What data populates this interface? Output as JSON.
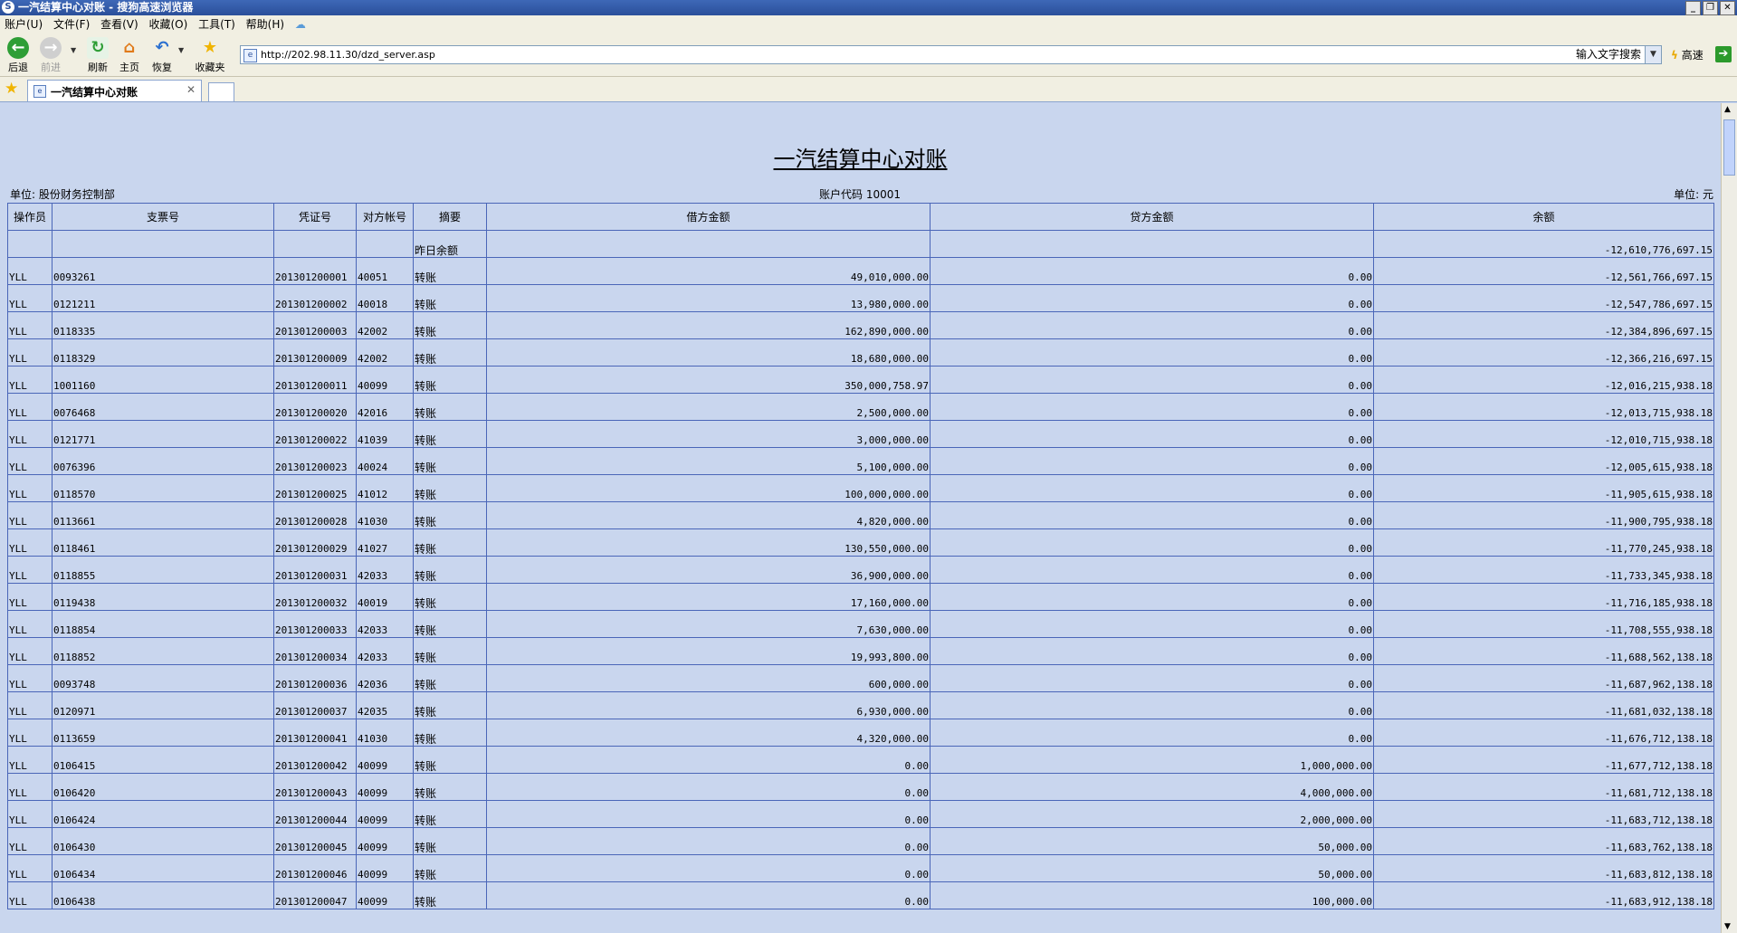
{
  "window": {
    "title": "一汽结算中心对账 - 搜狗高速浏览器",
    "app_icon": "S"
  },
  "menu": [
    "账户(U)",
    "文件(F)",
    "查看(V)",
    "收藏(O)",
    "工具(T)",
    "帮助(H)"
  ],
  "toolbar": {
    "back_label": "后退",
    "forward_label": "前进",
    "refresh_label": "刷新",
    "home_label": "主页",
    "restore_label": "恢复",
    "favorites_label": "收藏夹",
    "url": "http://202.98.11.30/dzd_server.asp",
    "search_label": "输入文字搜索",
    "speed_label": "高速"
  },
  "tabs": [
    {
      "title": "一汽结算中心对账"
    }
  ],
  "report": {
    "title": "一汽结算中心对账",
    "unit_dept_label": "单位: 股份财务控制部",
    "account_code_label": "账户代码 10001",
    "currency_unit_label": "单位: 元",
    "columns": [
      "操作员",
      "支票号",
      "凭证号",
      "对方帐号",
      "摘要",
      "借方金额",
      "贷方金额",
      "余额"
    ],
    "opening_row": {
      "summary": "昨日余额",
      "balance": "-12,610,776,697.15"
    },
    "rows": [
      {
        "op": "YLL",
        "check": "0093261",
        "voucher": "201301200001",
        "acct": "40051",
        "summary": "转账",
        "debit": "49,010,000.00",
        "credit": "0.00",
        "balance": "-12,561,766,697.15"
      },
      {
        "op": "YLL",
        "check": "0121211",
        "voucher": "201301200002",
        "acct": "40018",
        "summary": "转账",
        "debit": "13,980,000.00",
        "credit": "0.00",
        "balance": "-12,547,786,697.15"
      },
      {
        "op": "YLL",
        "check": "0118335",
        "voucher": "201301200003",
        "acct": "42002",
        "summary": "转账",
        "debit": "162,890,000.00",
        "credit": "0.00",
        "balance": "-12,384,896,697.15"
      },
      {
        "op": "YLL",
        "check": "0118329",
        "voucher": "201301200009",
        "acct": "42002",
        "summary": "转账",
        "debit": "18,680,000.00",
        "credit": "0.00",
        "balance": "-12,366,216,697.15"
      },
      {
        "op": "YLL",
        "check": "1001160",
        "voucher": "201301200011",
        "acct": "40099",
        "summary": "转账",
        "debit": "350,000,758.97",
        "credit": "0.00",
        "balance": "-12,016,215,938.18"
      },
      {
        "op": "YLL",
        "check": "0076468",
        "voucher": "201301200020",
        "acct": "42016",
        "summary": "转账",
        "debit": "2,500,000.00",
        "credit": "0.00",
        "balance": "-12,013,715,938.18"
      },
      {
        "op": "YLL",
        "check": "0121771",
        "voucher": "201301200022",
        "acct": "41039",
        "summary": "转账",
        "debit": "3,000,000.00",
        "credit": "0.00",
        "balance": "-12,010,715,938.18"
      },
      {
        "op": "YLL",
        "check": "0076396",
        "voucher": "201301200023",
        "acct": "40024",
        "summary": "转账",
        "debit": "5,100,000.00",
        "credit": "0.00",
        "balance": "-12,005,615,938.18"
      },
      {
        "op": "YLL",
        "check": "0118570",
        "voucher": "201301200025",
        "acct": "41012",
        "summary": "转账",
        "debit": "100,000,000.00",
        "credit": "0.00",
        "balance": "-11,905,615,938.18"
      },
      {
        "op": "YLL",
        "check": "0113661",
        "voucher": "201301200028",
        "acct": "41030",
        "summary": "转账",
        "debit": "4,820,000.00",
        "credit": "0.00",
        "balance": "-11,900,795,938.18"
      },
      {
        "op": "YLL",
        "check": "0118461",
        "voucher": "201301200029",
        "acct": "41027",
        "summary": "转账",
        "debit": "130,550,000.00",
        "credit": "0.00",
        "balance": "-11,770,245,938.18"
      },
      {
        "op": "YLL",
        "check": "0118855",
        "voucher": "201301200031",
        "acct": "42033",
        "summary": "转账",
        "debit": "36,900,000.00",
        "credit": "0.00",
        "balance": "-11,733,345,938.18"
      },
      {
        "op": "YLL",
        "check": "0119438",
        "voucher": "201301200032",
        "acct": "40019",
        "summary": "转账",
        "debit": "17,160,000.00",
        "credit": "0.00",
        "balance": "-11,716,185,938.18"
      },
      {
        "op": "YLL",
        "check": "0118854",
        "voucher": "201301200033",
        "acct": "42033",
        "summary": "转账",
        "debit": "7,630,000.00",
        "credit": "0.00",
        "balance": "-11,708,555,938.18"
      },
      {
        "op": "YLL",
        "check": "0118852",
        "voucher": "201301200034",
        "acct": "42033",
        "summary": "转账",
        "debit": "19,993,800.00",
        "credit": "0.00",
        "balance": "-11,688,562,138.18"
      },
      {
        "op": "YLL",
        "check": "0093748",
        "voucher": "201301200036",
        "acct": "42036",
        "summary": "转账",
        "debit": "600,000.00",
        "credit": "0.00",
        "balance": "-11,687,962,138.18"
      },
      {
        "op": "YLL",
        "check": "0120971",
        "voucher": "201301200037",
        "acct": "42035",
        "summary": "转账",
        "debit": "6,930,000.00",
        "credit": "0.00",
        "balance": "-11,681,032,138.18"
      },
      {
        "op": "YLL",
        "check": "0113659",
        "voucher": "201301200041",
        "acct": "41030",
        "summary": "转账",
        "debit": "4,320,000.00",
        "credit": "0.00",
        "balance": "-11,676,712,138.18"
      },
      {
        "op": "YLL",
        "check": "0106415",
        "voucher": "201301200042",
        "acct": "40099",
        "summary": "转账",
        "debit": "0.00",
        "credit": "1,000,000.00",
        "balance": "-11,677,712,138.18"
      },
      {
        "op": "YLL",
        "check": "0106420",
        "voucher": "201301200043",
        "acct": "40099",
        "summary": "转账",
        "debit": "0.00",
        "credit": "4,000,000.00",
        "balance": "-11,681,712,138.18"
      },
      {
        "op": "YLL",
        "check": "0106424",
        "voucher": "201301200044",
        "acct": "40099",
        "summary": "转账",
        "debit": "0.00",
        "credit": "2,000,000.00",
        "balance": "-11,683,712,138.18"
      },
      {
        "op": "YLL",
        "check": "0106430",
        "voucher": "201301200045",
        "acct": "40099",
        "summary": "转账",
        "debit": "0.00",
        "credit": "50,000.00",
        "balance": "-11,683,762,138.18"
      },
      {
        "op": "YLL",
        "check": "0106434",
        "voucher": "201301200046",
        "acct": "40099",
        "summary": "转账",
        "debit": "0.00",
        "credit": "50,000.00",
        "balance": "-11,683,812,138.18"
      },
      {
        "op": "YLL",
        "check": "0106438",
        "voucher": "201301200047",
        "acct": "40099",
        "summary": "转账",
        "debit": "0.00",
        "credit": "100,000.00",
        "balance": "-11,683,912,138.18"
      }
    ]
  },
  "colors": {
    "page_bg": "#c9d6ee",
    "grid_border": "#4a66b8",
    "titlebar": "#2a4f9a"
  }
}
